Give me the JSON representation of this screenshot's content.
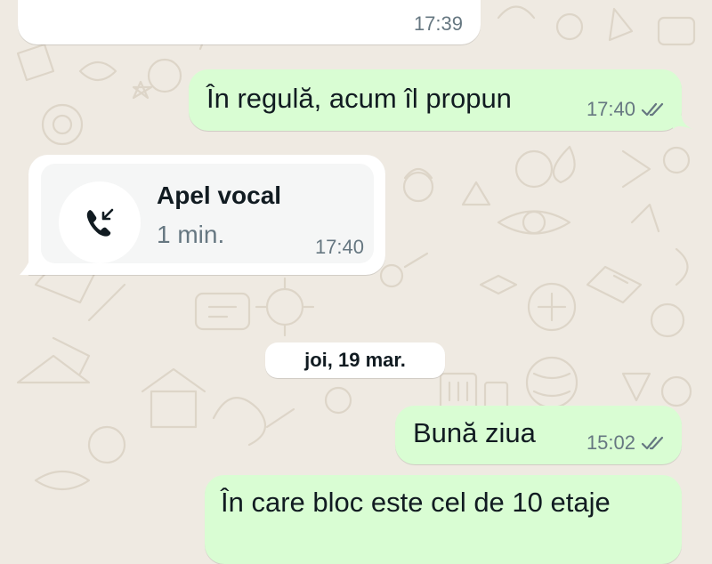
{
  "messages": [
    {
      "direction": "incoming",
      "text": "",
      "time": "17:39"
    },
    {
      "direction": "outgoing",
      "text": "În regulă, acum îl propun",
      "time": "17:40",
      "status": "read"
    },
    {
      "direction": "incoming",
      "type": "voice-call",
      "title": "Apel vocal",
      "duration": "1 min.",
      "time": "17:40",
      "icon": "incoming-call-icon"
    },
    {
      "direction": "outgoing",
      "text": "Bună ziua",
      "time": "15:02",
      "status": "read"
    },
    {
      "direction": "outgoing",
      "text": "În care bloc este cel de 10 etaje"
    }
  ],
  "date_separator": "joi, 19 mar.",
  "colors": {
    "chat_background": "#efeae2",
    "incoming_bubble": "#ffffff",
    "outgoing_bubble": "#d9fdd3",
    "timestamp": "#667781",
    "text": "#111b21"
  }
}
